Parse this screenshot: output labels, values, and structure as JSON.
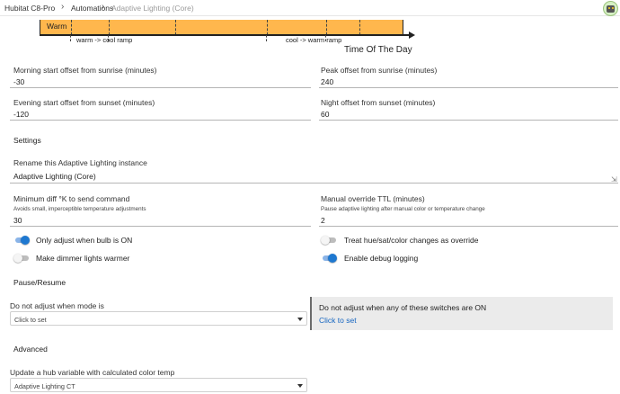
{
  "breadcrumb": {
    "hub": "Hubitat C8-Pro",
    "apps": "Automations",
    "current": "Adaptive Lighting (Core)",
    "separator": ">"
  },
  "timeline": {
    "band_label": "Warm",
    "band_color": "#ffb74d",
    "ramp_left": "warm -> cool ramp",
    "ramp_right": "cool -> warm ramp",
    "axis_title": "Time Of The Day"
  },
  "offsets": {
    "morning_label": "Morning start offset from sunrise (minutes)",
    "morning_value": "-30",
    "peak_label": "Peak offset from sunrise (minutes)",
    "peak_value": "240",
    "evening_label": "Evening start offset from sunset (minutes)",
    "evening_value": "-120",
    "night_label": "Night offset from sunset (minutes)",
    "night_value": "60"
  },
  "settings": {
    "heading": "Settings",
    "rename_label": "Rename this Adaptive Lighting instance",
    "rename_value": "Adaptive Lighting (Core)",
    "mindiff_label": "Minimum diff °K to send command",
    "mindiff_hint": "Avoids small, imperceptible temperature adjustments",
    "mindiff_value": "30",
    "ttl_label": "Manual override TTL (minutes)",
    "ttl_hint": "Pause adaptive lighting after manual color or temperature change",
    "ttl_value": "2"
  },
  "toggles": {
    "only_on_label": "Only adjust when bulb is ON",
    "only_on": true,
    "treat_hue_label": "Treat hue/sat/color changes as override",
    "treat_hue": false,
    "dimmer_warmer_label": "Make dimmer lights warmer",
    "dimmer_warmer": false,
    "debug_label": "Enable debug logging",
    "debug": true
  },
  "pause": {
    "heading": "Pause/Resume",
    "mode_label": "Do not adjust when mode is",
    "mode_value": "Click to set",
    "switches_label": "Do not adjust when any of these switches are ON",
    "switches_link": "Click to set"
  },
  "advanced": {
    "heading": "Advanced",
    "hubvar_label": "Update a hub variable with calculated color temp",
    "hubvar_value": "Adaptive Lighting CT"
  },
  "colors": {
    "accent": "#1e78d0",
    "link": "#1565c0",
    "band": "#ffb74d"
  }
}
